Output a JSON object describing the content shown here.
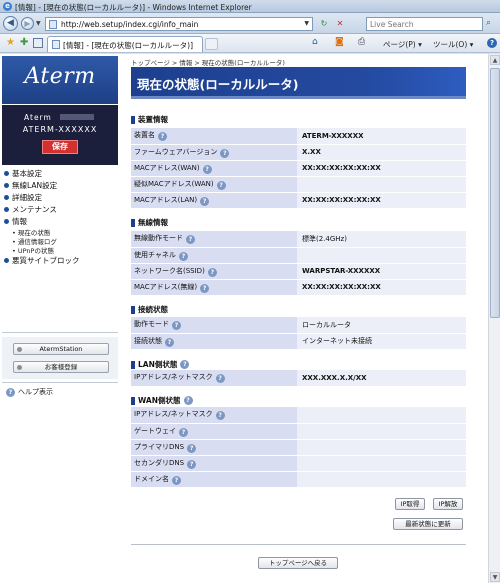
{
  "window": {
    "title": "[情報] - [現在の状態(ローカルルータ)] - Windows Internet Explorer"
  },
  "address": {
    "url": "http://web.setup/index.cgi/info_main",
    "search_placeholder": "Live Search"
  },
  "cmdbar": {
    "tab_label": "[情報] - [現在の状態(ローカルルータ)]",
    "page_menu": "ページ(P)",
    "tools_menu": "ツール(O)"
  },
  "sidebar": {
    "logo": "Aterm",
    "model_prefix": "Aterm",
    "device_name": "ATERM-XXXXXX",
    "save_label": "保存",
    "menu": [
      {
        "label": "基本設定"
      },
      {
        "label": "無線LAN設定"
      },
      {
        "label": "詳細設定"
      },
      {
        "label": "メンテナンス"
      },
      {
        "label": "情報",
        "children": [
          "現在の状態",
          "通信情報ログ",
          "UPnPの状態"
        ]
      },
      {
        "label": "悪質サイトブロック"
      }
    ],
    "aterm_station_label": "AtermStation",
    "register_label": "お客様登録",
    "help_label": "ヘルプ表示"
  },
  "breadcrumb": [
    "トップページ",
    ">",
    "情報",
    ">",
    "現在の状態(ローカルルータ)"
  ],
  "page_title": "現在の状態(ローカルルータ)",
  "sections": {
    "device": {
      "title": "装置情報",
      "rows": [
        {
          "label": "装置名",
          "value": "ATERM-XXXXXX"
        },
        {
          "label": "ファームウェアバージョン",
          "value": "X.XX"
        },
        {
          "label": "MACアドレス(WAN)",
          "value": "XX:XX:XX:XX:XX:XX"
        },
        {
          "label": "疑似MACアドレス(WAN)",
          "value": ""
        },
        {
          "label": "MACアドレス(LAN)",
          "value": "XX:XX:XX:XX:XX:XX"
        }
      ]
    },
    "wireless": {
      "title": "無線情報",
      "rows": [
        {
          "label": "無線動作モード",
          "value": "標準(2.4GHz)"
        },
        {
          "label": "使用チャネル",
          "value": ""
        },
        {
          "label": "ネットワーク名(SSID)",
          "value": "WARPSTAR-XXXXXX"
        },
        {
          "label": "MACアドレス(無線)",
          "value": "XX:XX:XX:XX:XX:XX"
        }
      ]
    },
    "connection": {
      "title": "接続状態",
      "rows": [
        {
          "label": "動作モード",
          "value": "ローカルルータ"
        },
        {
          "label": "接続状態",
          "value": "インターネット未接続"
        }
      ]
    },
    "lan": {
      "title": "LAN側状態",
      "rows": [
        {
          "label": "IPアドレス/ネットマスク",
          "value": "XXX.XXX.X.X/XX"
        }
      ]
    },
    "wan": {
      "title": "WAN側状態",
      "rows": [
        {
          "label": "IPアドレス/ネットマスク",
          "value": ""
        },
        {
          "label": "ゲートウェイ",
          "value": ""
        },
        {
          "label": "プライマリDNS",
          "value": ""
        },
        {
          "label": "セカンダリDNS",
          "value": ""
        },
        {
          "label": "ドメイン名",
          "value": ""
        }
      ]
    }
  },
  "buttons": {
    "ip_release": "IP取得",
    "ip_renew": "IP解放",
    "refresh": "最新状態に更新",
    "back_to_top": "トップページへ戻る"
  }
}
